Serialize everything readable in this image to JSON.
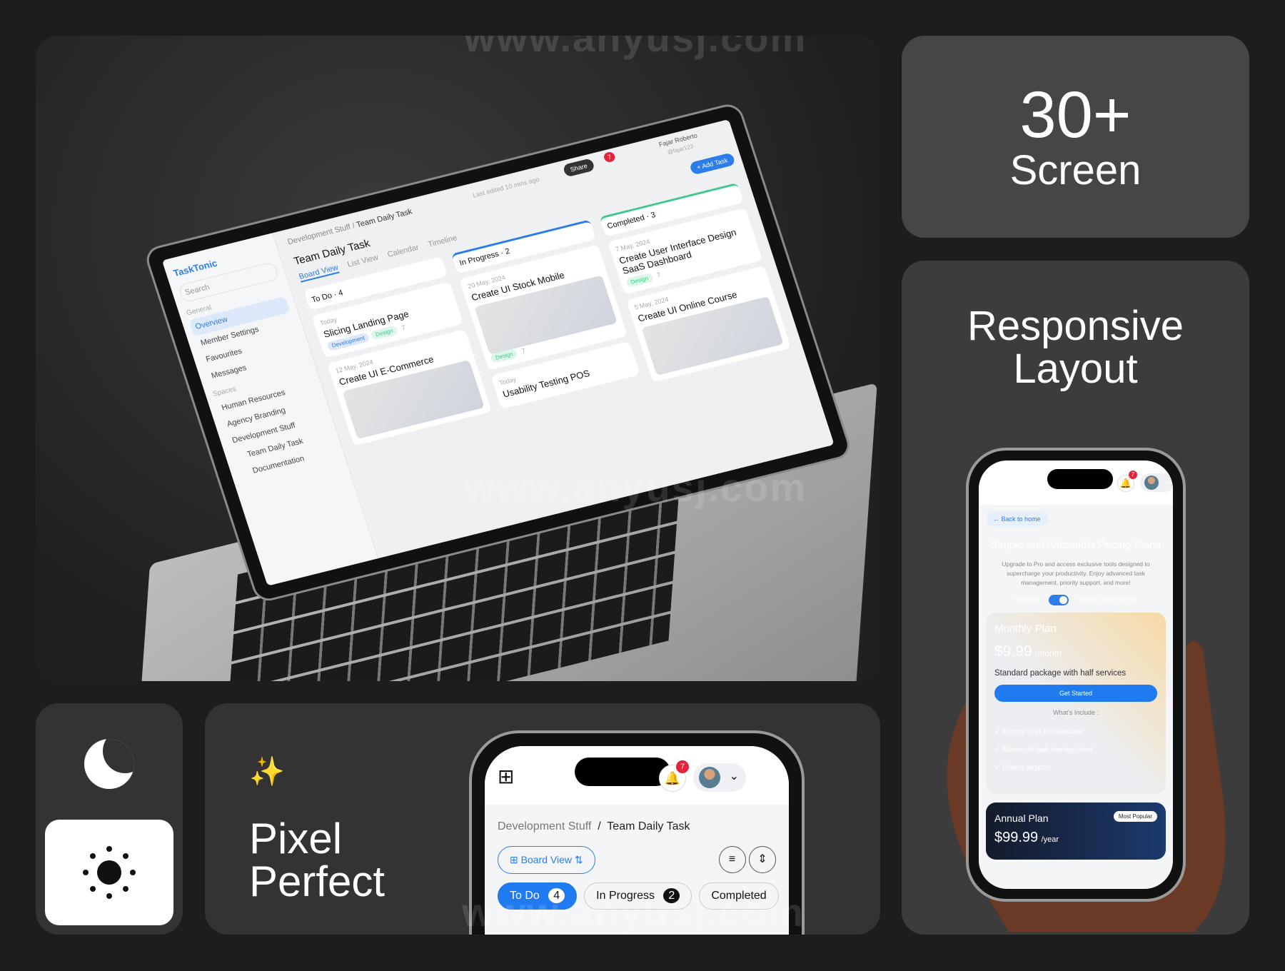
{
  "watermark": "www.anyusj.com",
  "screens_card": {
    "count": "30+",
    "label": "Screen"
  },
  "responsive_card": {
    "title_line1": "Responsive",
    "title_line2": "Layout"
  },
  "pixel_card": {
    "line1": "Pixel",
    "line2": "Perfect"
  },
  "mode_card": {
    "dark_icon": "moon-icon",
    "light_icon": "sun-icon"
  },
  "laptop_app": {
    "logo": "TaskTonic",
    "search": "Search",
    "general": "General",
    "nav": [
      "Overview",
      "Member Settings",
      "Favourites",
      "Messages"
    ],
    "spaces": "Spaces",
    "space_items": [
      "Human Resources",
      "Agency Branding",
      "Development Stuff",
      "Team Daily Task",
      "Documentation"
    ],
    "breadcrumb": [
      "Development Stuff",
      "/",
      "Team Daily Task"
    ],
    "last_edited": "Last edited 10 mins ago",
    "share": "Share",
    "notifications": "7",
    "user_name": "Fajar Roberto",
    "user_handle": "@fajar123",
    "title": "Team Daily Task",
    "tabs": [
      "Board View",
      "List View",
      "Calendar",
      "Timeline"
    ],
    "add_task": "+ Add Task",
    "columns": [
      {
        "name": "To Do",
        "count": "4",
        "cards": [
          {
            "date": "Today",
            "title": "Slicing Landing Page",
            "tags": [
              "Development",
              "Design"
            ],
            "comments": "7"
          },
          {
            "date": "12 May, 2024",
            "title": "Create UI E-Commerce"
          }
        ]
      },
      {
        "name": "In Progress",
        "count": "2",
        "cards": [
          {
            "date": "20 May, 2024",
            "title": "Create UI Stock Mobile",
            "tags": [
              "Design"
            ],
            "comments": "7"
          },
          {
            "date": "Today",
            "title": "Usability Testing POS"
          }
        ]
      },
      {
        "name": "Completed",
        "count": "3",
        "cards": [
          {
            "date": "7 May, 2024",
            "title": "Create User Interface Design SaaS Dashboard",
            "tags": [
              "Design"
            ],
            "comments": "7"
          },
          {
            "date": "5 May, 2024",
            "title": "Create UI Online Course"
          }
        ]
      }
    ],
    "colors": {
      "accent": "#2b7de9",
      "completed": "#3cc98a"
    }
  },
  "pricing_phone": {
    "notifications": "7",
    "back": "Back to home",
    "title": "Simple and Affordable Pricing Plans",
    "description": "Upgrade to Pro and access exclusive tools designed to supercharge your productivity. Enjoy advanced task management, priority support, and more!",
    "toggle_left": "Monthly",
    "toggle_right": "Yearly (Save 20%)",
    "toggle_on": true,
    "monthly": {
      "name": "Monthly Plan",
      "price": "$9.99",
      "period": "/month",
      "desc": "Standard package with half services",
      "cta": "Get Started",
      "includes_label": "What's Include :",
      "features": [
        "Access to all Pro features",
        "Advanced task management",
        "Priority support"
      ]
    },
    "annual": {
      "name": "Annual Plan",
      "badge": "Most Popular",
      "price": "$99.99",
      "period": "/year"
    }
  },
  "board_phone": {
    "notifications": "7",
    "breadcrumb": [
      "Development Stuff",
      "/",
      "Team Daily Task"
    ],
    "view": "Board View",
    "tabs": [
      {
        "label": "To Do",
        "count": "4"
      },
      {
        "label": "In Progress",
        "count": "2"
      },
      {
        "label": "Completed"
      }
    ]
  }
}
